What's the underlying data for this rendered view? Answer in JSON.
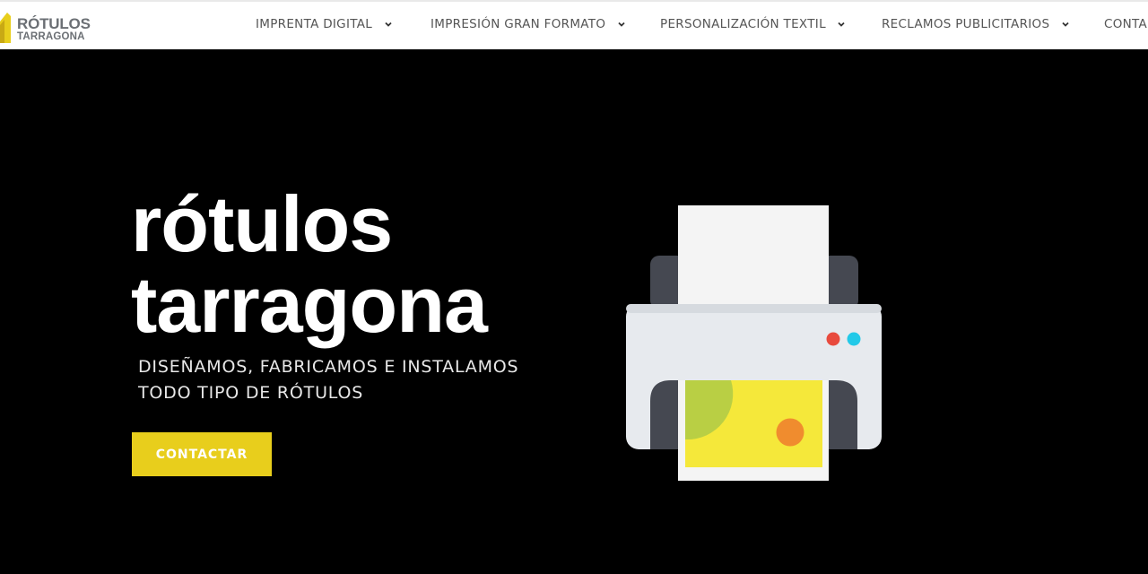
{
  "brand": {
    "line1": "RÓTULOS",
    "line2": "TARRAGONA",
    "logo_icon": "brand-mark"
  },
  "nav": {
    "items": [
      {
        "label": "IMPRENTA DIGITAL",
        "icon": "chevron-down-icon"
      },
      {
        "label": "IMPRESIÓN GRAN FORMATO",
        "icon": "chevron-down-icon"
      },
      {
        "label": "PERSONALIZACIÓN TEXTIL",
        "icon": "chevron-down-icon"
      },
      {
        "label": "RECLAMOS PUBLICITARIOS",
        "icon": "chevron-down-icon"
      },
      {
        "label": "CONTA"
      }
    ]
  },
  "hero": {
    "title_line1": "rótulos",
    "title_line2": "tarragona",
    "subtitle_line1": "DISEÑAMOS, FABRICAMOS E INSTALAMOS",
    "subtitle_line2": "TODO TIPO DE RÓTULOS",
    "cta_label": "CONTACTAR",
    "illustration_icon": "printer-illustration"
  },
  "colors": {
    "accent": "#e8ce1c",
    "background": "#000000",
    "nav_text": "#555555",
    "logo_gray": "#6b6f74"
  }
}
